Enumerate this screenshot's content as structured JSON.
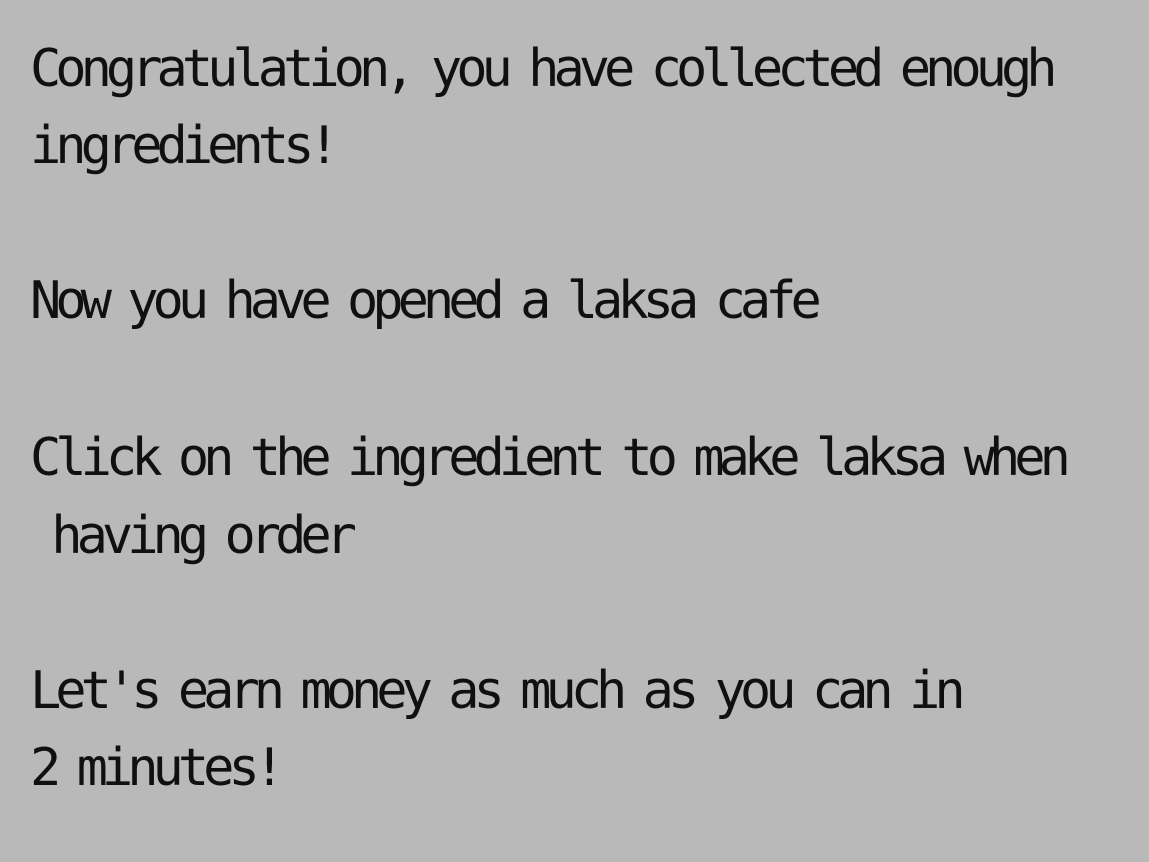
{
  "instructions": {
    "lines": [
      "Congratulation, you have collected enough",
      "ingredients!",
      "Now you have opened a laksa cafe",
      "Click on the ingredient to make laksa when",
      " having order",
      "Let's earn money as much as you can in",
      "2 minutes!"
    ]
  },
  "colors": {
    "background": "#b9b9b9",
    "text": "#101010"
  }
}
